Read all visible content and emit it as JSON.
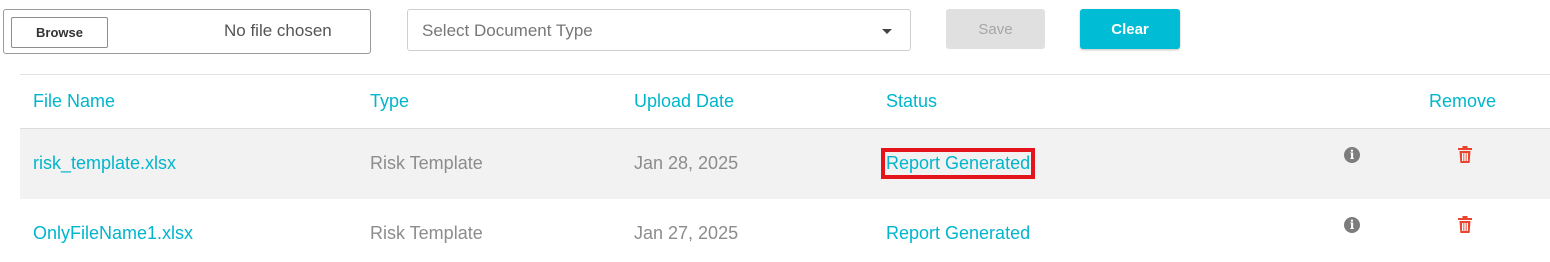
{
  "upload": {
    "browse_label": "Browse",
    "file_status": "No file chosen",
    "doc_type_placeholder": "Select Document Type",
    "save_label": "Save",
    "clear_label": "Clear"
  },
  "table": {
    "headers": {
      "file_name": "File Name",
      "type": "Type",
      "upload_date": "Upload Date",
      "status": "Status",
      "remove": "Remove"
    },
    "rows": [
      {
        "file_name": "risk_template.xlsx",
        "type": "Risk Template",
        "upload_date": "Jan 28, 2025",
        "status": "Report Generated",
        "highlighted": true
      },
      {
        "file_name": "OnlyFileName1.xlsx",
        "type": "Risk Template",
        "upload_date": "Jan 27, 2025",
        "status": "Report Generated",
        "highlighted": false
      }
    ]
  },
  "icons": {
    "info": "info-circle-icon",
    "remove": "trash-icon",
    "dropdown": "caret-down-icon"
  },
  "colors": {
    "accent": "#00bcd4",
    "remove_icon": "#e8442f",
    "highlight_box": "#e3141b",
    "row_shade": "#f2f2f2"
  }
}
